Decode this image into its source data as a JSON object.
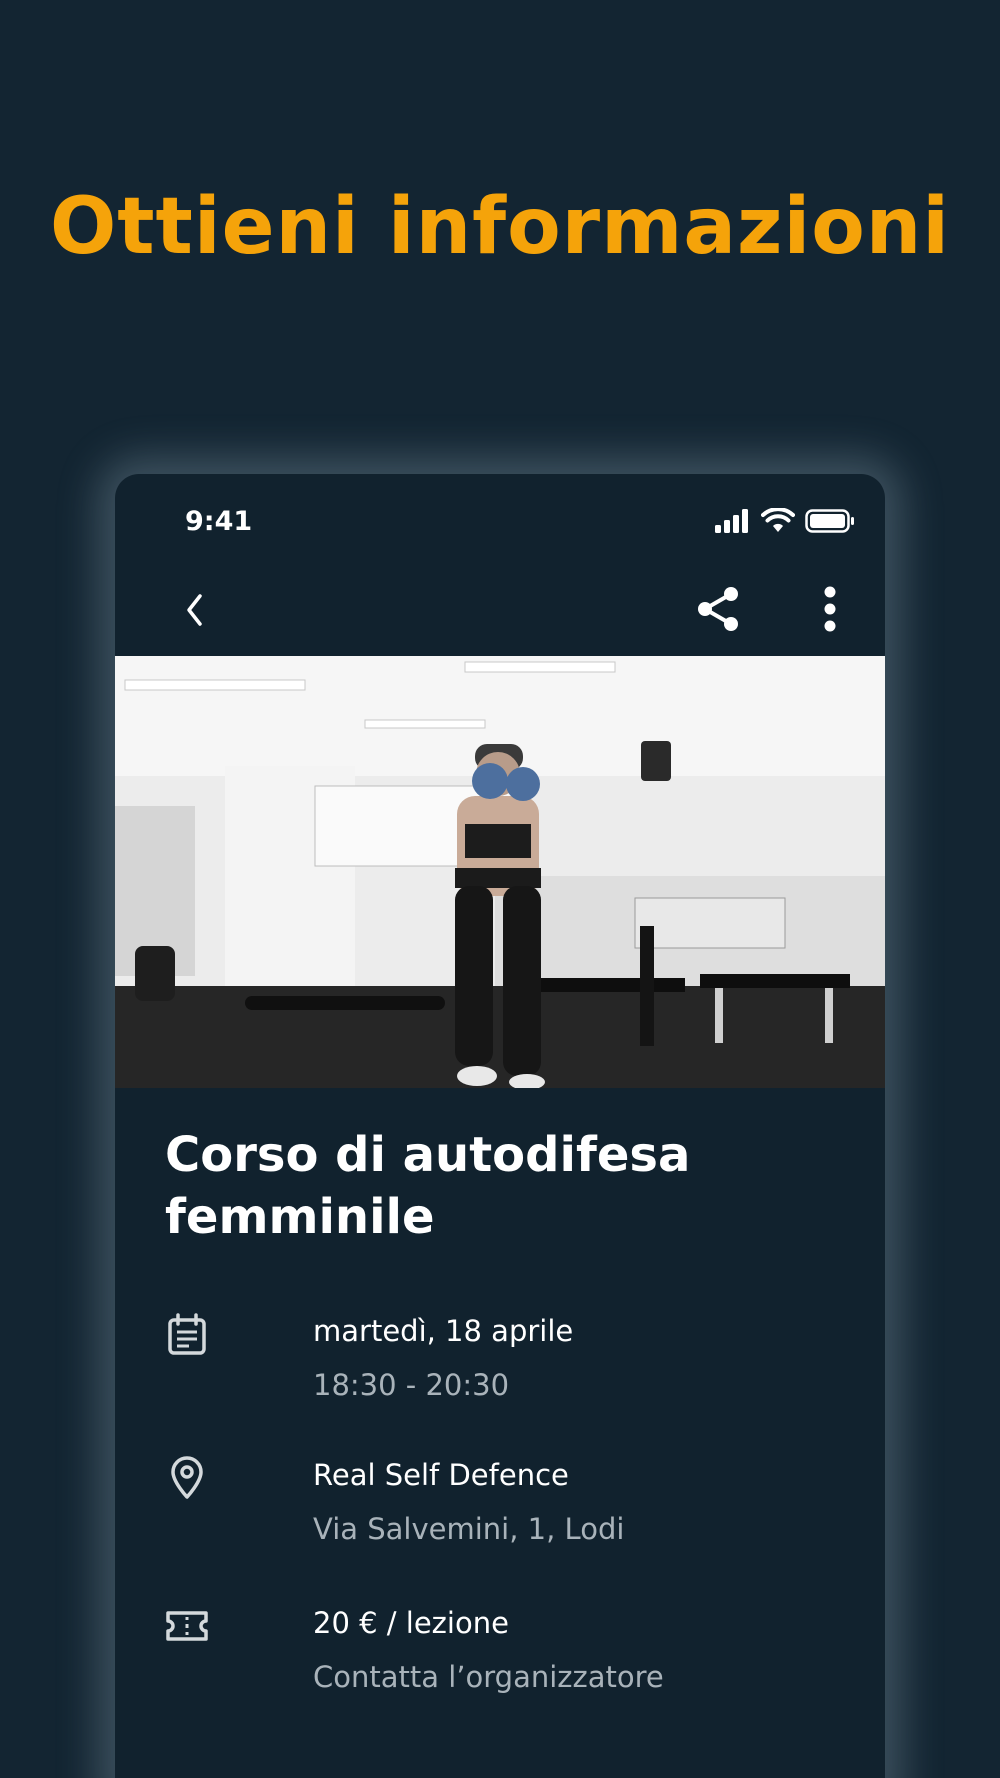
{
  "headline": "Ottieni informazioni",
  "colors": {
    "accent": "#F5A30A",
    "background": "#132532",
    "card": "#11222E",
    "secondary_text": "#A9B3BA"
  },
  "status_bar": {
    "time": "9:41"
  },
  "nav": {
    "back_icon": "chevron-left-icon",
    "share_icon": "share-icon",
    "more_icon": "more-vertical-icon"
  },
  "event": {
    "title": "Corso di autodifesa femminile",
    "date": "martedì, 18 aprile",
    "time": "18:30 - 20:30",
    "venue": "Real Self Defence",
    "address": "Via Salvemini, 1, Lodi",
    "price": "20 € / lezione",
    "contact": "Contatta l’organizzatore"
  }
}
